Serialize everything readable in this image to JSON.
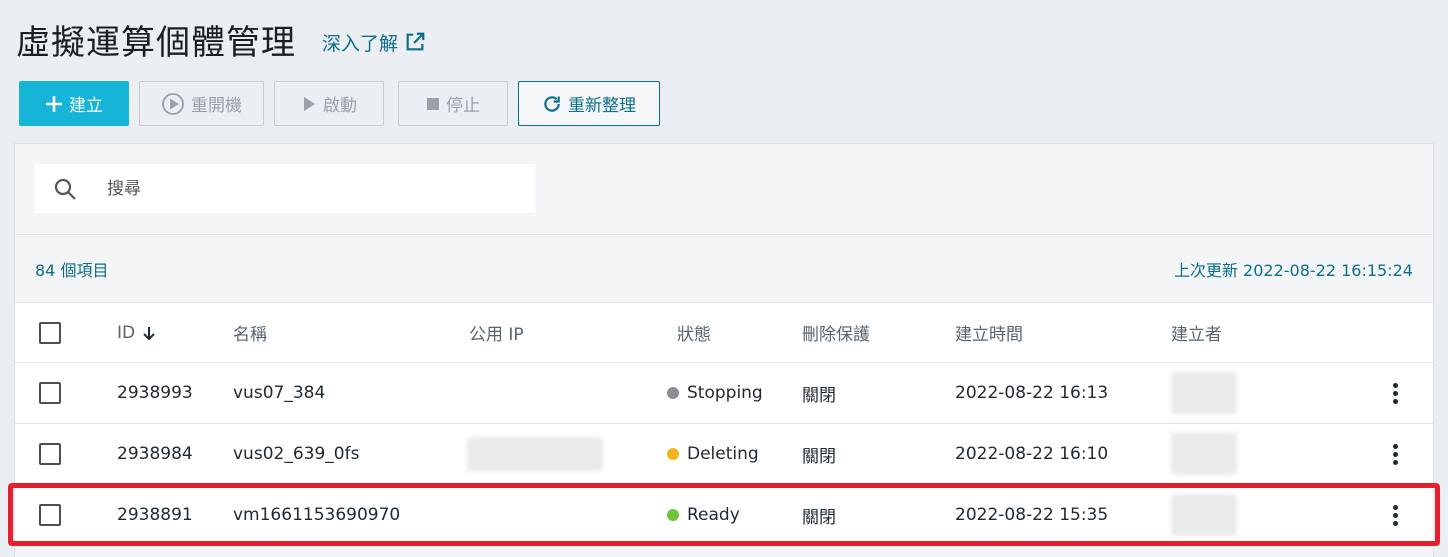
{
  "header": {
    "title": "虛擬運算個體管理",
    "learn_more": "深入了解"
  },
  "toolbar": {
    "create": "建立",
    "reboot": "重開機",
    "start": "啟動",
    "stop": "停止",
    "refresh": "重新整理"
  },
  "search": {
    "placeholder": "搜尋"
  },
  "summary": {
    "count": "84 個項目",
    "last_updated": "上次更新 2022-08-22 16:15:24"
  },
  "table": {
    "columns": {
      "id": "ID",
      "name": "名稱",
      "public_ip": "公用 IP",
      "status": "狀態",
      "delete_protection": "刪除保護",
      "created_time": "建立時間",
      "creator": "建立者"
    },
    "rows": [
      {
        "id": "2938993",
        "name": "vus07_384",
        "status": "Stopping",
        "status_color": "#8a8d91",
        "delete_protection": "關閉",
        "created_time": "2022-08-22 16:13"
      },
      {
        "id": "2938984",
        "name": "vus02_639_0fs",
        "status": "Deleting",
        "status_color": "#f0b41f",
        "delete_protection": "關閉",
        "created_time": "2022-08-22 16:10"
      },
      {
        "id": "2938891",
        "name": "vm1661153690970",
        "status": "Ready",
        "status_color": "#6fc43a",
        "delete_protection": "關閉",
        "created_time": "2022-08-22 15:35"
      }
    ]
  },
  "colors": {
    "primary": "#16b4d6",
    "link": "#0b6f8a",
    "highlight": "#e3202b"
  }
}
